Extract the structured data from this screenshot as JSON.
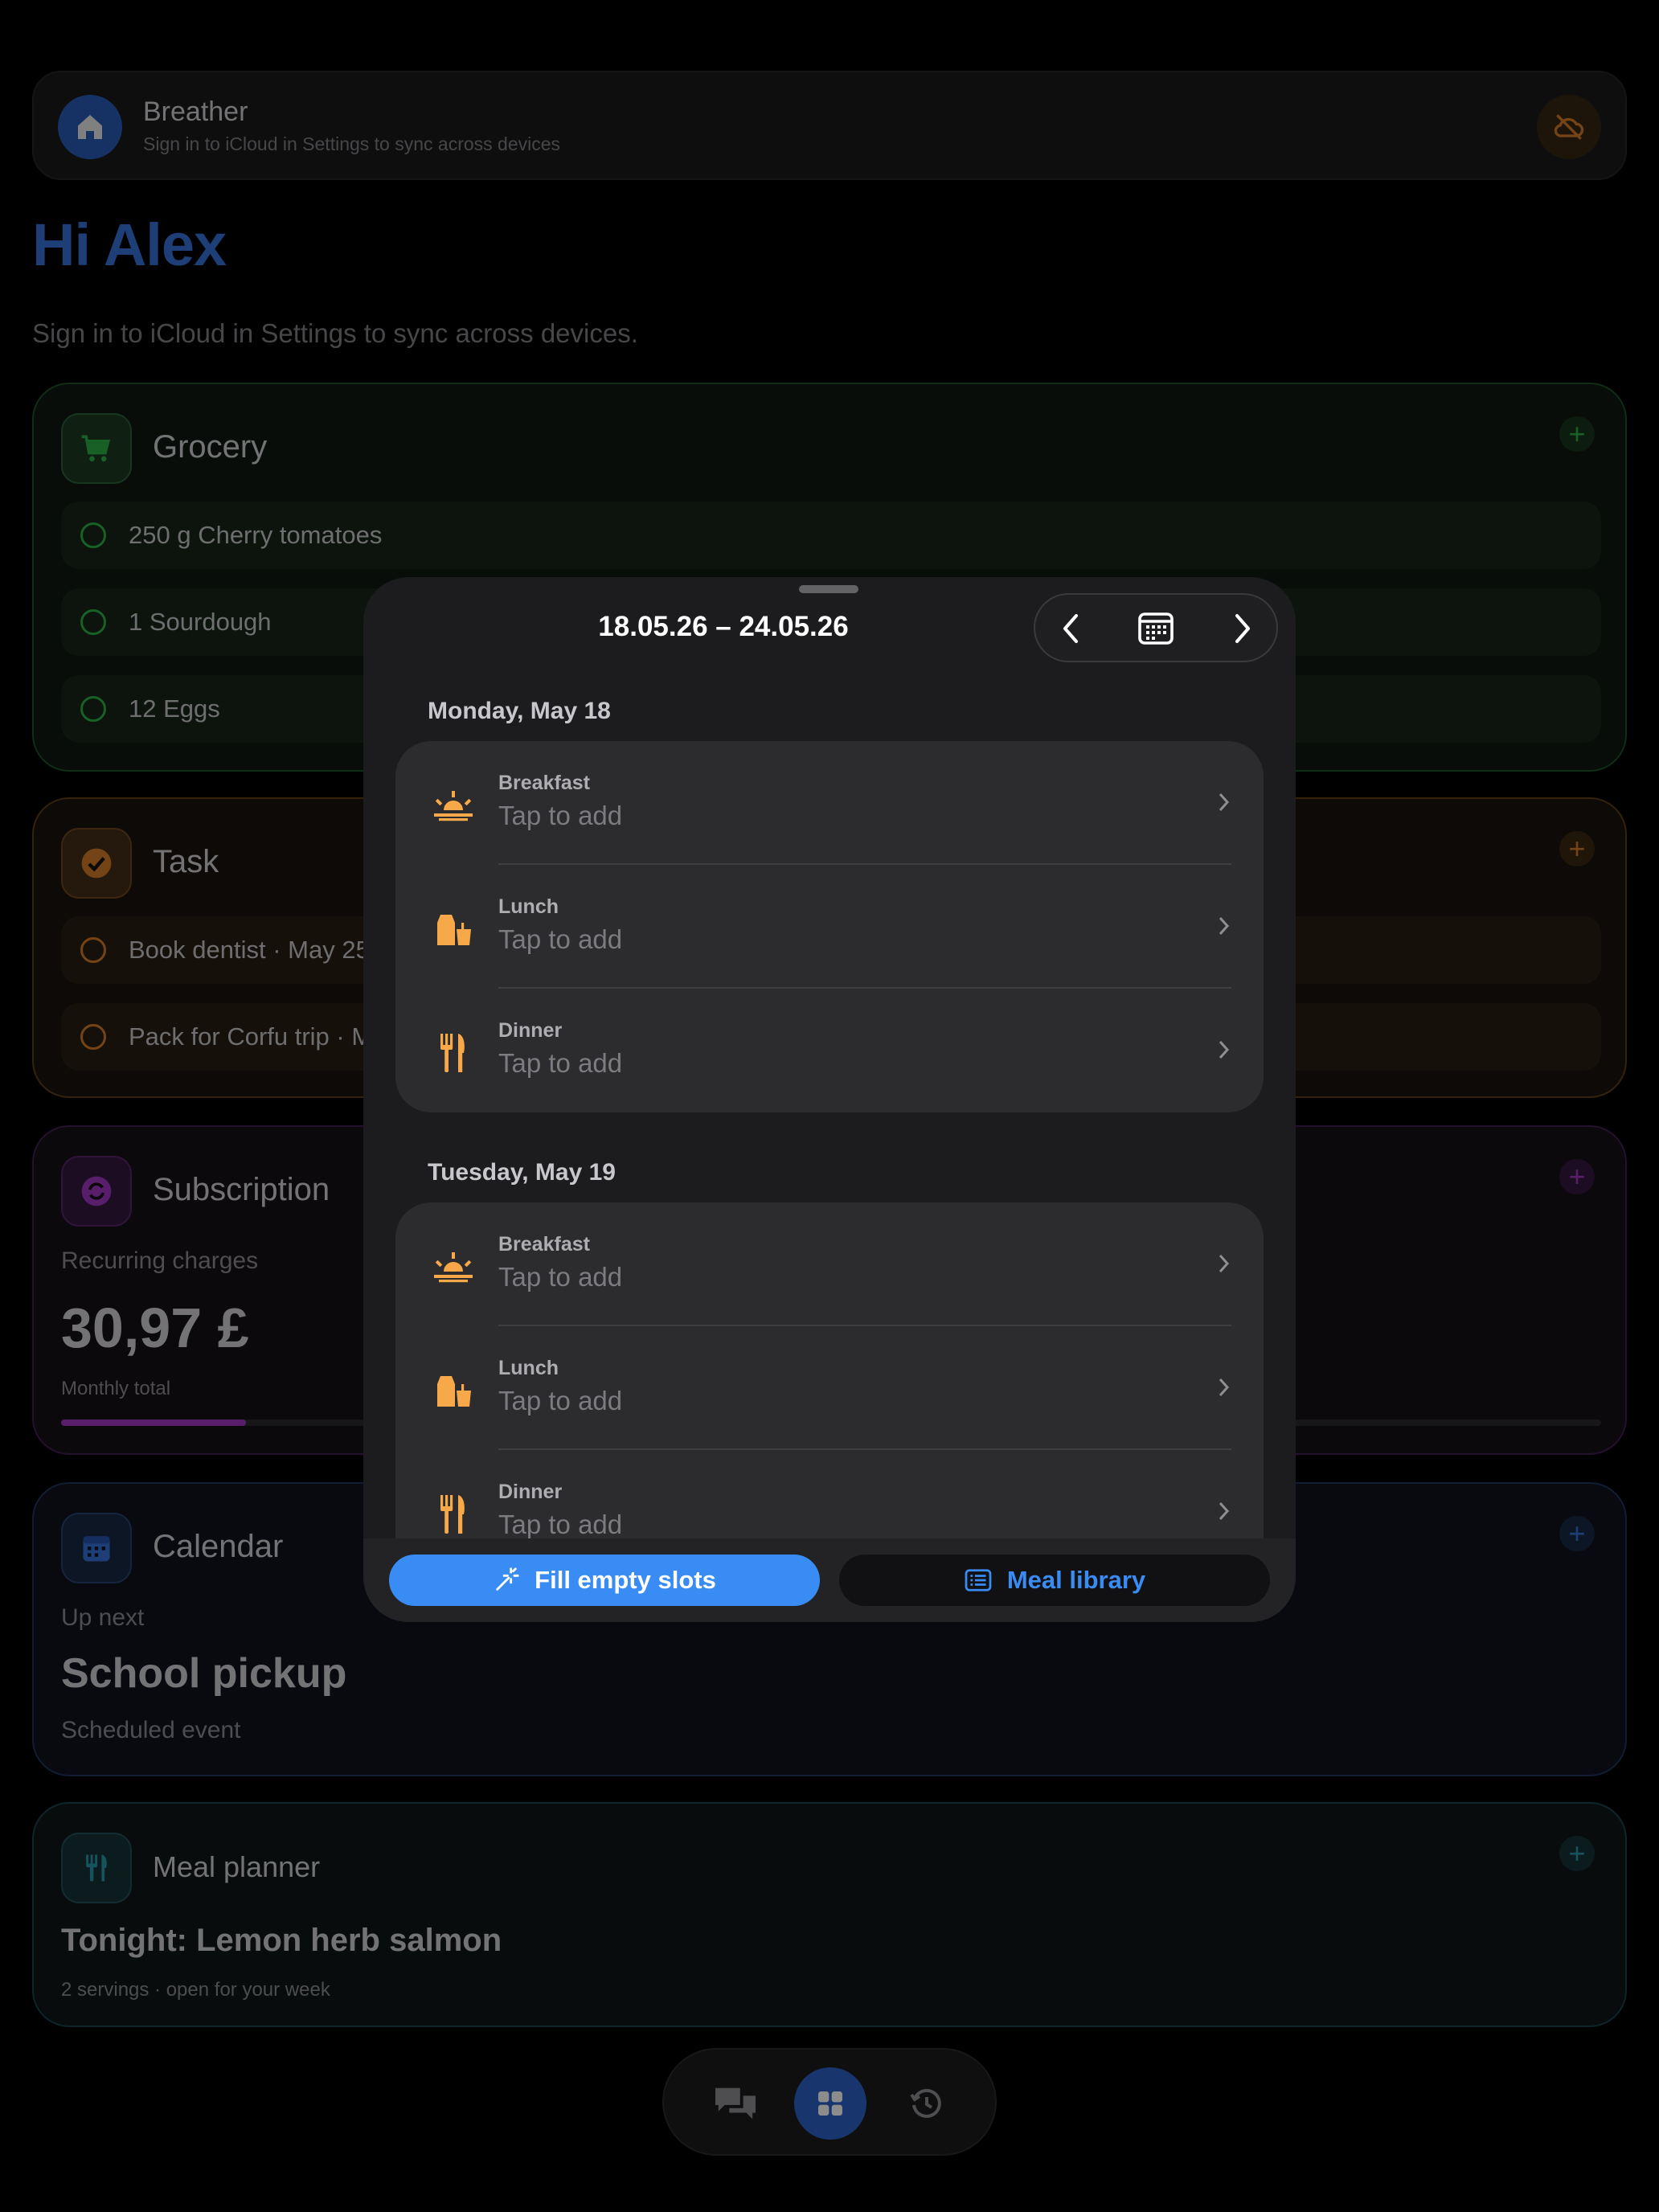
{
  "header": {
    "app_name": "Breather",
    "subtitle": "Sign in to iCloud in Settings to sync across devices",
    "home_icon": "house-icon",
    "sync_icon": "cloud-slash-icon"
  },
  "greeting": {
    "title": "Hi Alex",
    "subtitle": "Sign in to iCloud in Settings to sync across devices."
  },
  "grocery": {
    "title": "Grocery",
    "add": "+",
    "items": [
      "250 g Cherry tomatoes",
      "1 Sourdough",
      "12 Eggs"
    ],
    "color": "#2fbf4d"
  },
  "task": {
    "title": "Task",
    "add": "+",
    "items": [
      "Book dentist · May 25",
      "Pack for Corfu trip · M"
    ],
    "color": "#e8892b"
  },
  "subscription": {
    "title": "Subscription",
    "add": "+",
    "label": "Recurring charges",
    "amount": "30,97 £",
    "caption": "Monthly total",
    "progress": 0.12,
    "color": "#b03bd6"
  },
  "calendar": {
    "title": "Calendar",
    "add": "+",
    "label": "Up next",
    "event": "School pickup",
    "caption": "Scheduled event",
    "color": "#3b7bf0"
  },
  "meal_planner": {
    "title": "Meal planner",
    "add": "+",
    "tonight": "Tonight: Lemon herb salmon",
    "caption": "2 servings · open for your week",
    "color": "#2aa7b8"
  },
  "sheet": {
    "date_range": "18.05.26 – 24.05.26",
    "days": [
      {
        "label": "Monday, May 18",
        "meals": [
          {
            "name": "Breakfast",
            "value": "Tap to add",
            "icon": "sunrise-icon"
          },
          {
            "name": "Lunch",
            "value": "Tap to add",
            "icon": "takeout-bag-icon"
          },
          {
            "name": "Dinner",
            "value": "Tap to add",
            "icon": "fork-knife-icon"
          }
        ]
      },
      {
        "label": "Tuesday, May 19",
        "meals": [
          {
            "name": "Breakfast",
            "value": "Tap to add",
            "icon": "sunrise-icon"
          },
          {
            "name": "Lunch",
            "value": "Tap to add",
            "icon": "takeout-bag-icon"
          },
          {
            "name": "Dinner",
            "value": "Tap to add",
            "icon": "fork-knife-icon"
          }
        ]
      }
    ],
    "fill_button": "Fill empty slots",
    "library_button": "Meal library",
    "accent": "#3a8cf5",
    "meal_icon_color": "#f7a94a"
  },
  "bottom_nav": {
    "items": [
      "chat-bubbles-icon",
      "grid-icon",
      "history-icon"
    ],
    "active": "grid-icon"
  }
}
